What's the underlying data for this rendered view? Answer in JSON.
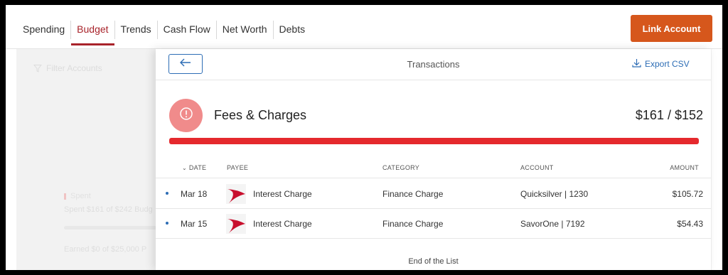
{
  "nav": {
    "tabs": [
      {
        "label": "Spending"
      },
      {
        "label": "Budget"
      },
      {
        "label": "Trends"
      },
      {
        "label": "Cash Flow"
      },
      {
        "label": "Net Worth"
      },
      {
        "label": "Debts"
      }
    ],
    "active_tab": "Budget",
    "link_account_label": "Link Account"
  },
  "background": {
    "filter_label": "Filter Accounts",
    "spent_label": "Spent",
    "spent_text": "Spent $161 of $242 Budg",
    "earned_text": "Earned $0 of $25,000 P"
  },
  "panel": {
    "title": "Transactions",
    "export_label": "Export CSV",
    "category": {
      "name": "Fees & Charges",
      "amount": "$161 / $152",
      "progress_percent": 100
    },
    "columns": {
      "date": "DATE",
      "payee": "PAYEE",
      "category": "CATEGORY",
      "account": "ACCOUNT",
      "amount": "AMOUNT"
    },
    "rows": [
      {
        "date": "Mar 18",
        "payee": "Interest Charge",
        "category": "Finance Charge",
        "account": "Quicksilver | 1230",
        "amount": "$105.72"
      },
      {
        "date": "Mar 15",
        "payee": "Interest Charge",
        "category": "Finance Charge",
        "account": "SavorOne | 7192",
        "amount": "$54.43"
      }
    ],
    "end_text": "End of the List"
  },
  "colors": {
    "accent_red": "#a8232a",
    "button_orange": "#d6571c",
    "link_blue": "#2d6db5",
    "progress_red": "#e5292d",
    "category_icon_bg": "#f08b8b"
  }
}
